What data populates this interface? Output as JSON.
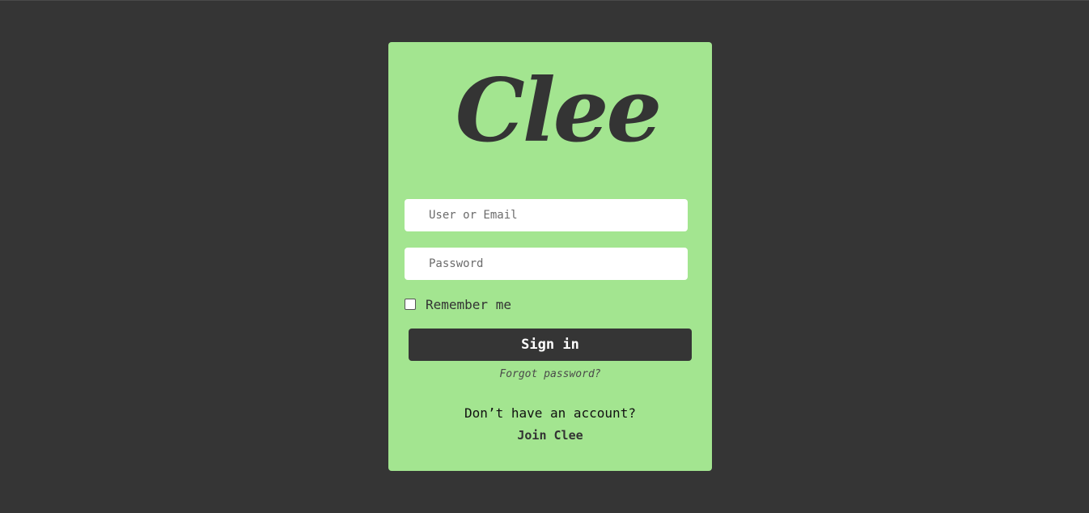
{
  "brand": {
    "logo_text": "Clee"
  },
  "login": {
    "user_placeholder": "User or Email",
    "password_placeholder": "Password",
    "remember_label": "Remember me",
    "remember_checked": false,
    "signin_label": "Sign in",
    "forgot_label": "Forgot password?",
    "no_account_text": "Don’t have an account?",
    "join_label": "Join Clee"
  },
  "colors": {
    "background": "#353535",
    "card": "#a3e590",
    "button": "#353535",
    "button_text": "#ffffff",
    "text_dark": "#333333"
  }
}
